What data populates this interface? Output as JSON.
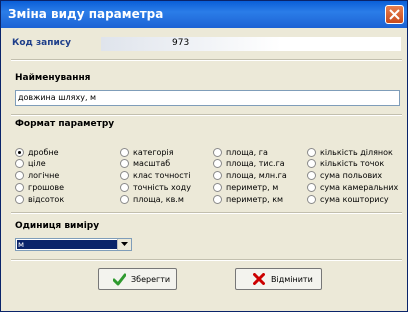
{
  "window": {
    "title": "Зміна виду параметра"
  },
  "record": {
    "label": "Код запису",
    "value": "973"
  },
  "name_section": {
    "label": "Найменування",
    "value": "довжина шляху, м"
  },
  "format_section": {
    "label": "Формат параметру",
    "options": [
      [
        "дробне",
        "ціле",
        "логічне",
        "грошове",
        "відсоток"
      ],
      [
        "категорія",
        "масштаб",
        "клас точності",
        "точність ходу",
        "площа, кв.м"
      ],
      [
        "площа, га",
        "площа, тис.га",
        "площа, млн.га",
        "периметр, м",
        "периметр, км"
      ],
      [
        "кількість ділянок",
        "кількість точок",
        "сума польових",
        "сума камеральних",
        "сума кошторису"
      ]
    ],
    "selected": "дробне"
  },
  "unit_section": {
    "label": "Одиниця виміру",
    "value": "м"
  },
  "buttons": {
    "save": "Зберегти",
    "cancel": "Відмінити"
  },
  "colors": {
    "accent": "#0a5fd8",
    "cancel_icon": "#cc0000",
    "save_icon": "#2f9a2f"
  }
}
